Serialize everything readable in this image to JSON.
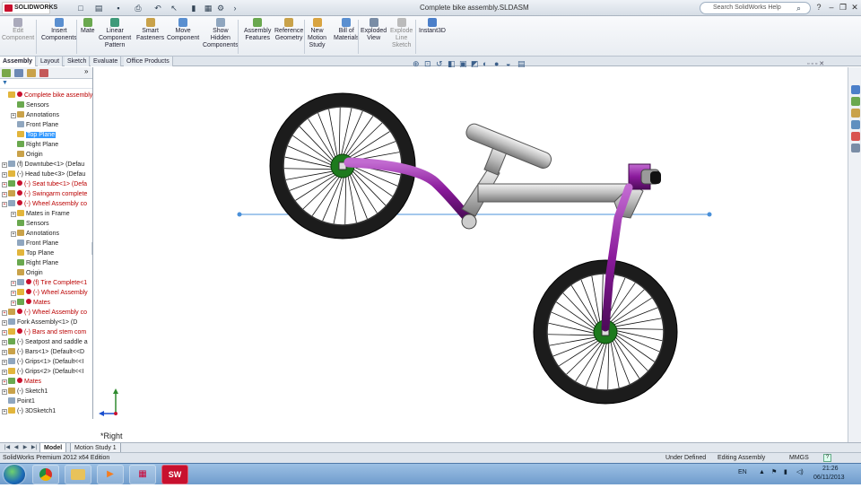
{
  "app": {
    "logo": "SOLIDWORKS",
    "window_title": "Complete bike assembly.SLDASM",
    "search_placeholder": "Search SolidWorks Help",
    "help_icon": "?"
  },
  "toolbar": {
    "buttons": [
      {
        "label": "Edit\nComponent",
        "icon": "edit-component-icon",
        "dim": true
      },
      {
        "label": "Insert\nComponents",
        "icon": "insert-components-icon"
      },
      {
        "label": "Mate",
        "icon": "mate-icon"
      },
      {
        "label": "Linear\nComponent\nPattern",
        "icon": "linear-pattern-icon"
      },
      {
        "label": "Smart\nFasteners",
        "icon": "smart-fasteners-icon"
      },
      {
        "label": "Move\nComponent",
        "icon": "move-component-icon"
      },
      {
        "label": "Show\nHidden\nComponents",
        "icon": "show-hidden-icon"
      },
      {
        "label": "Assembly\nFeatures",
        "icon": "assembly-features-icon"
      },
      {
        "label": "Reference\nGeometry",
        "icon": "reference-geometry-icon"
      },
      {
        "label": "New\nMotion\nStudy",
        "icon": "motion-study-icon"
      },
      {
        "label": "Bill of\nMaterials",
        "icon": "bom-icon"
      },
      {
        "label": "Exploded\nView",
        "icon": "exploded-view-icon"
      },
      {
        "label": "Explode\nLine\nSketch",
        "icon": "explode-line-icon",
        "dim": true
      },
      {
        "label": "Instant3D",
        "icon": "instant3d-icon"
      }
    ]
  },
  "tabs": [
    "Assembly",
    "Layout",
    "Sketch",
    "Evaluate",
    "Office Products"
  ],
  "tree": [
    {
      "label": "Complete bike assembly",
      "level": 0,
      "red": true,
      "expander": false
    },
    {
      "label": "Sensors",
      "level": 1
    },
    {
      "label": "Annotations",
      "level": 1,
      "expander": true
    },
    {
      "label": "Front Plane",
      "level": 1
    },
    {
      "label": "Top Plane",
      "level": 1,
      "selected": true
    },
    {
      "label": "Right Plane",
      "level": 1
    },
    {
      "label": "Origin",
      "level": 1
    },
    {
      "label": "(f) Downtube<1> (Defau",
      "level": 0,
      "expander": true
    },
    {
      "label": "(-) Head tube<3> (Defau",
      "level": 0,
      "expander": true
    },
    {
      "label": "(-) Seat tube<1> (Defa",
      "level": 0,
      "expander": true,
      "red": true
    },
    {
      "label": "(-) Swingarm complete",
      "level": 0,
      "expander": true,
      "red": true
    },
    {
      "label": "(-) Wheel Assembly co",
      "level": 0,
      "expander": true,
      "red": true
    },
    {
      "label": "Mates in Frame",
      "level": 1,
      "expander": true
    },
    {
      "label": "Sensors",
      "level": 1
    },
    {
      "label": "Annotations",
      "level": 1,
      "expander": true
    },
    {
      "label": "Front Plane",
      "level": 1
    },
    {
      "label": "Top Plane",
      "level": 1
    },
    {
      "label": "Right Plane",
      "level": 1
    },
    {
      "label": "Origin",
      "level": 1
    },
    {
      "label": "(f) Tire Complete<1",
      "level": 1,
      "expander": true,
      "red": true
    },
    {
      "label": "(-) Wheel Assembly",
      "level": 1,
      "expander": true,
      "red": true
    },
    {
      "label": "Mates",
      "level": 1,
      "expander": true,
      "red": true
    },
    {
      "label": "(-) Wheel Assembly co",
      "level": 0,
      "expander": true,
      "red": true
    },
    {
      "label": "Fork Assembly<1> (D",
      "level": 0,
      "expander": true
    },
    {
      "label": "(-) Bars and stem com",
      "level": 0,
      "expander": true,
      "red": true
    },
    {
      "label": "(-) Seatpost and saddle a",
      "level": 0,
      "expander": true
    },
    {
      "label": "(-) Bars<1> (Default<<D",
      "level": 0,
      "expander": true
    },
    {
      "label": "(-) Grips<1> (Default<<I",
      "level": 0,
      "expander": true
    },
    {
      "label": "(-) Grips<2> (Default<<I",
      "level": 0,
      "expander": true
    },
    {
      "label": "Mates",
      "level": 0,
      "expander": true,
      "red": true
    },
    {
      "label": "(-) Sketch1",
      "level": 0,
      "expander": true
    },
    {
      "label": "Point1",
      "level": 0
    },
    {
      "label": "(-) 3DSketch1",
      "level": 0,
      "expander": true
    }
  ],
  "bottom_tabs": [
    "Model",
    "Motion Study 1"
  ],
  "view_label": "*Right",
  "status": {
    "left": "SolidWorks Premium 2012 x64 Edition",
    "defined": "Under Defined",
    "editing": "Editing Assembly",
    "units": "MMGS"
  },
  "taskbar": {
    "language": "EN",
    "time": "21:26",
    "date": "06/11/2013",
    "apps": [
      "chrome-icon",
      "explorer-folder-icon",
      "media-player-icon",
      "app-grid-icon",
      "solidworks-icon"
    ]
  },
  "colors": {
    "frame": "#8a1a9b",
    "tire": "#1c1c1c",
    "hub": "#1d7a1d",
    "tube_metal": "#c8c8c8",
    "selection": "#3399ff",
    "error_text": "#bb0000"
  }
}
